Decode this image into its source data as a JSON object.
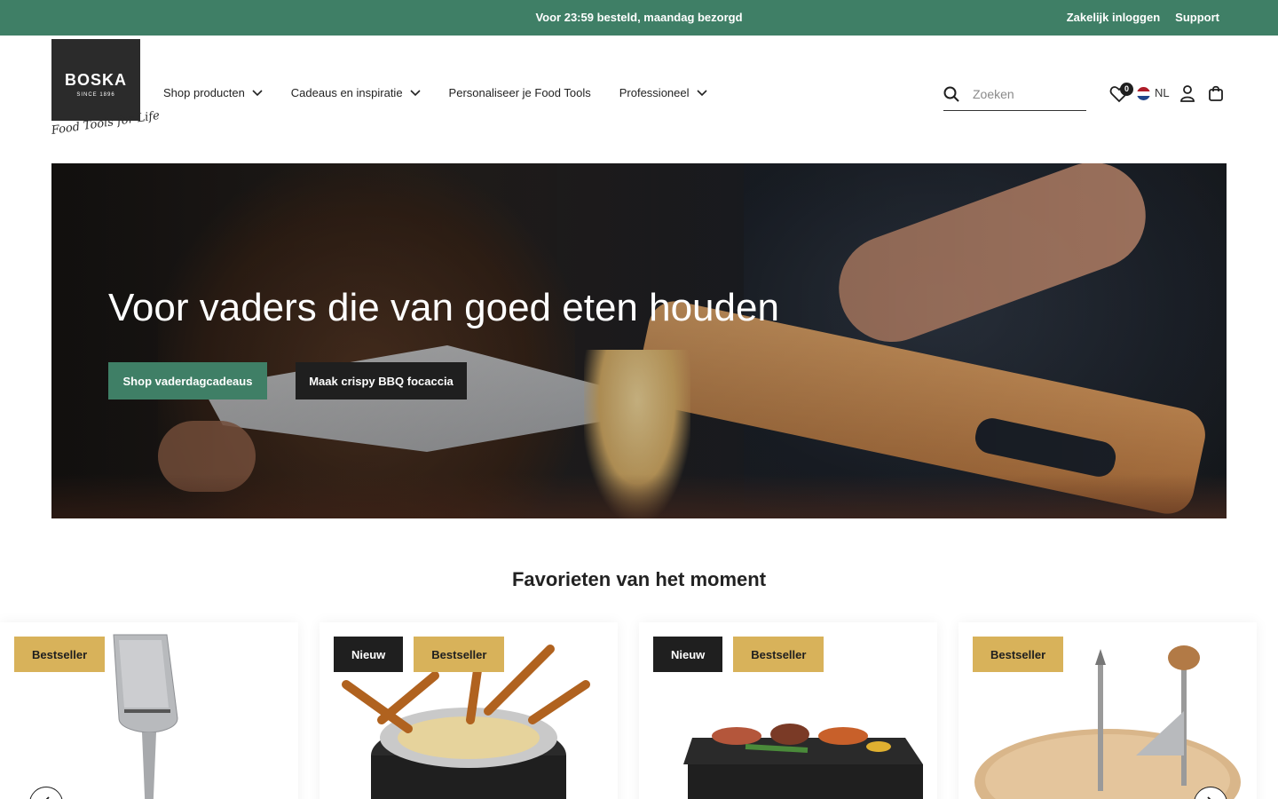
{
  "topbar": {
    "promo": "Voor 23:59 besteld, maandag bezorgd",
    "business_login": "Zakelijk inloggen",
    "support": "Support"
  },
  "header": {
    "logo_wordmark": "BOSKA",
    "logo_since": "SINCE 1896",
    "tagline": "Food Tools for Life",
    "nav": [
      {
        "label": "Shop producten",
        "has_dropdown": true
      },
      {
        "label": "Cadeaus en inspiratie",
        "has_dropdown": true
      },
      {
        "label": "Personaliseer je Food Tools",
        "has_dropdown": false
      },
      {
        "label": "Professioneel",
        "has_dropdown": true
      }
    ],
    "search_placeholder": "Zoeken",
    "wishlist_count": "0",
    "language": "NL"
  },
  "hero": {
    "title": "Voor vaders die van goed eten houden",
    "primary_button": "Shop vaderdagcadeaus",
    "secondary_button": "Maak crispy BBQ focaccia"
  },
  "favorites": {
    "title": "Favorieten van het moment",
    "products": [
      {
        "badges": [
          "Bestseller"
        ],
        "image": "cheese slicer"
      },
      {
        "badges": [
          "Nieuw",
          "Bestseller"
        ],
        "image": "fondue set"
      },
      {
        "badges": [
          "Nieuw",
          "Bestseller"
        ],
        "image": "raclette grill"
      },
      {
        "badges": [
          "Bestseller"
        ],
        "image": "girolle cheese curler"
      }
    ]
  },
  "colors": {
    "brand_green": "#3f7f66",
    "dark": "#1f1f1f",
    "bestseller_gold": "#d8b25a"
  },
  "icons": [
    "search-icon",
    "heart-icon",
    "account-icon",
    "cart-icon",
    "chevron-down-icon",
    "flag-nl-icon",
    "arrow-left-icon",
    "arrow-right-icon"
  ]
}
